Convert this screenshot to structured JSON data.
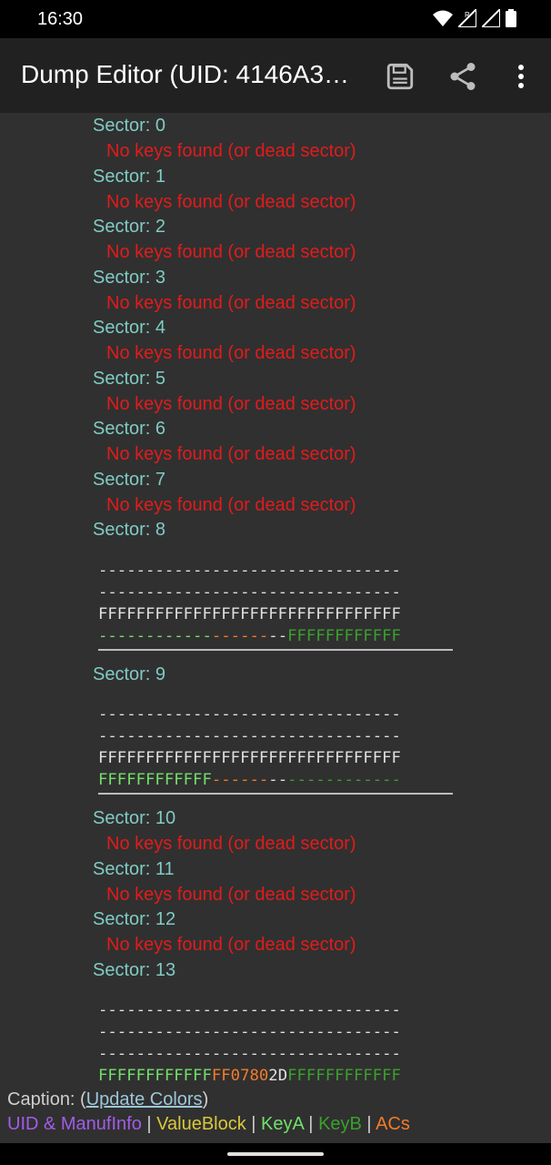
{
  "status_bar": {
    "time": "16:30",
    "icons": [
      "wifi-icon",
      "signal-roaming-icon",
      "signal-icon",
      "battery-icon"
    ]
  },
  "app_bar": {
    "title": "Dump Editor (UID: 4146A3…",
    "actions": [
      "save-icon",
      "share-icon",
      "more-vert-icon"
    ]
  },
  "sectors": [
    {
      "label": "Sector: 0",
      "message": "No keys found (or dead sector)"
    },
    {
      "label": "Sector: 1",
      "message": "No keys found (or dead sector)"
    },
    {
      "label": "Sector: 2",
      "message": "No keys found (or dead sector)"
    },
    {
      "label": "Sector: 3",
      "message": "No keys found (or dead sector)"
    },
    {
      "label": "Sector: 4",
      "message": "No keys found (or dead sector)"
    },
    {
      "label": "Sector: 5",
      "message": "No keys found (or dead sector)"
    },
    {
      "label": "Sector: 6",
      "message": "No keys found (or dead sector)"
    },
    {
      "label": "Sector: 7",
      "message": "No keys found (or dead sector)"
    },
    {
      "label": "Sector: 8",
      "blocks": [
        "--------------------------------",
        "--------------------------------",
        "FFFFFFFFFFFFFFFFFFFFFFFFFFFFFFFF"
      ],
      "trailer": {
        "key_a": "------------",
        "acs": "------",
        "gpb": "--",
        "key_b": "FFFFFFFFFFFF"
      }
    },
    {
      "label": "Sector: 9",
      "blocks": [
        "--------------------------------",
        "--------------------------------",
        "FFFFFFFFFFFFFFFFFFFFFFFFFFFFFFFF"
      ],
      "trailer": {
        "key_a": "FFFFFFFFFFFF",
        "acs": "------",
        "gpb": "--",
        "key_b": "------------"
      }
    },
    {
      "label": "Sector: 10",
      "message": "No keys found (or dead sector)"
    },
    {
      "label": "Sector: 11",
      "message": "No keys found (or dead sector)"
    },
    {
      "label": "Sector: 12",
      "message": "No keys found (or dead sector)"
    },
    {
      "label": "Sector: 13",
      "blocks": [
        "--------------------------------",
        "--------------------------------",
        "--------------------------------"
      ],
      "trailer": {
        "key_a": "FFFFFFFFFFFF",
        "acs": "FF0780",
        "gpb": "2D",
        "key_b": "FFFFFFFFFFFF"
      }
    }
  ],
  "caption": {
    "prefix": "Caption: (",
    "link": "Update Colors",
    "suffix": ")",
    "legend": {
      "uid": "UID & ManufInfo",
      "value_block": "ValueBlock",
      "key_a": "KeyA",
      "key_b": "KeyB",
      "acs": "ACs",
      "sep": " | "
    }
  }
}
